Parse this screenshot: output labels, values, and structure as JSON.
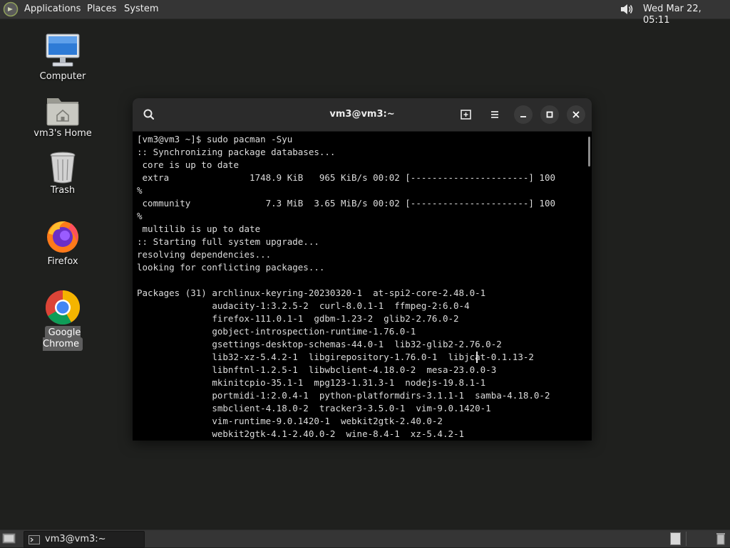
{
  "top_panel": {
    "menus": [
      "Applications",
      "Places",
      "System"
    ],
    "clock": "Wed Mar 22, 05:11"
  },
  "desktop_icons": [
    {
      "label": "Computer",
      "icon": "computer-icon"
    },
    {
      "label": "vm3's Home",
      "icon": "home-folder-icon"
    },
    {
      "label": "Trash",
      "icon": "trash-icon"
    },
    {
      "label": "Firefox",
      "icon": "firefox-icon"
    },
    {
      "label": "Google Chrome",
      "icon": "chrome-icon",
      "selected": true
    }
  ],
  "terminal": {
    "title": "vm3@vm3:~",
    "header_buttons": [
      "search-icon",
      "new-tab-icon",
      "hamburger-menu-icon",
      "minimize-icon",
      "maximize-icon",
      "close-icon"
    ],
    "lines": [
      "[vm3@vm3 ~]$ sudo pacman -Syu",
      ":: Synchronizing package databases...",
      " core is up to date",
      " extra               1748.9 KiB   965 KiB/s 00:02 [----------------------] 100",
      "%",
      " community              7.3 MiB  3.65 MiB/s 00:02 [----------------------] 100",
      "%",
      " multilib is up to date",
      ":: Starting full system upgrade...",
      "resolving dependencies...",
      "looking for conflicting packages...",
      "",
      "Packages (31) archlinux-keyring-20230320-1  at-spi2-core-2.48.0-1",
      "              audacity-1:3.2.5-2  curl-8.0.1-1  ffmpeg-2:6.0-4",
      "              firefox-111.0.1-1  gdbm-1.23-2  glib2-2.76.0-2",
      "              gobject-introspection-runtime-1.76.0-1",
      "              gsettings-desktop-schemas-44.0-1  lib32-glib2-2.76.0-2",
      "              lib32-xz-5.4.2-1  libgirepository-1.76.0-1  libjcat-0.1.13-2",
      "              libnftnl-1.2.5-1  libwbclient-4.18.0-2  mesa-23.0.0-3",
      "              mkinitcpio-35.1-1  mpg123-1.31.3-1  nodejs-19.8.1-1",
      "              portmidi-1:2.0.4-1  python-platformdirs-3.1.1-1  samba-4.18.0-2",
      "              smbclient-4.18.0-2  tracker3-3.5.0-1  vim-9.0.1420-1",
      "              vim-runtime-9.0.1420-1  webkit2gtk-2.40.0-2",
      "              webkit2gtk-4.1-2.40.0-2  wine-8.4-1  xz-5.4.2-1"
    ]
  },
  "bottom_panel": {
    "task_label": "vm3@vm3:~"
  },
  "colors": {
    "desktop_bg": "#1f201e",
    "panel_bg": "#353535",
    "terminal_bg": "#000000",
    "terminal_fg": "#dcdcdc",
    "header_bg": "#2b2b2b"
  }
}
